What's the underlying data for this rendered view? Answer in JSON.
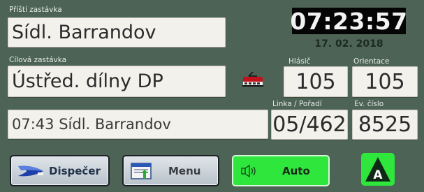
{
  "next_stop": {
    "label": "Příští zastávka",
    "value": "Sídl. Barrandov"
  },
  "destination": {
    "label": "Cílová zastávka",
    "value": "Ústřed. dílny DP"
  },
  "clock": {
    "time": "07:23:57",
    "date": "17. 02. 2018"
  },
  "announcer": {
    "label": "Hlásič",
    "value": "105"
  },
  "orientation": {
    "label": "Orientace",
    "value": "105"
  },
  "line_order": {
    "label": "Linka / Pořadí",
    "value": "05/462"
  },
  "vehicle_number": {
    "label": "Ev. číslo",
    "value": "8525"
  },
  "departure_info": "07:43 Sídl. Barrandov",
  "buttons": {
    "dispatcher": "Dispečer",
    "menu": "Menu",
    "auto": "Auto",
    "mode_letter": "A"
  },
  "icons": [
    "tram-icon",
    "dispatcher-icon",
    "menu-icon",
    "speaker-icon",
    "mode-icon"
  ],
  "colors": {
    "background": "#4d6355",
    "auto_active": "#2ee63c",
    "clock_bg": "#050505"
  }
}
